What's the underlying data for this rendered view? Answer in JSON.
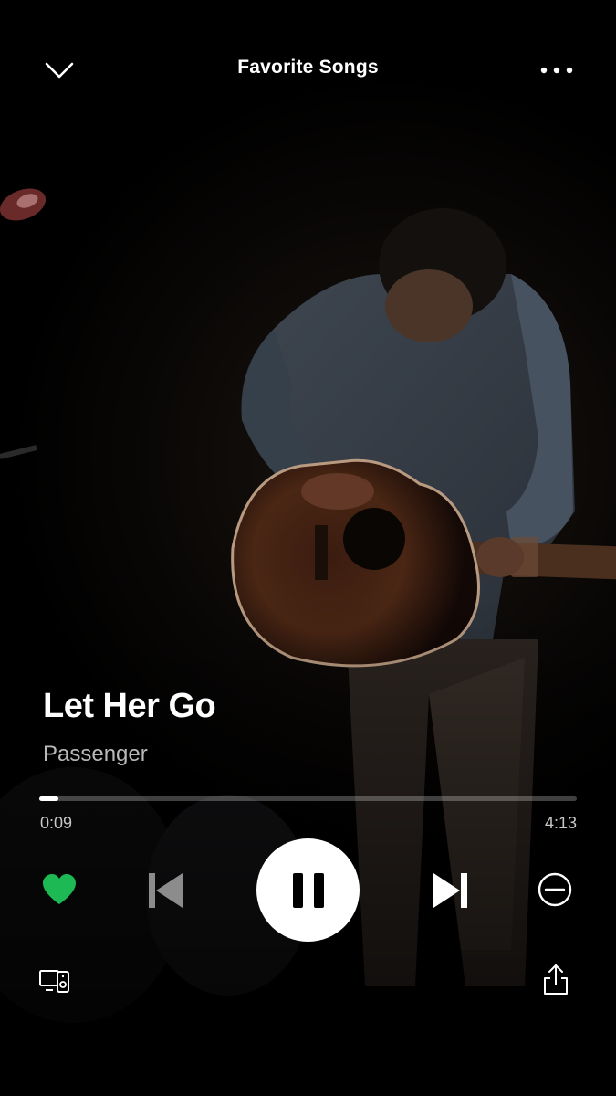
{
  "header": {
    "title": "Favorite Songs",
    "collapse_icon": "chevron-down-icon",
    "menu_icon": "more-horizontal-icon"
  },
  "track": {
    "title": "Let Her Go",
    "artist": "Passenger",
    "liked": true
  },
  "playback": {
    "elapsed": "0:09",
    "total": "4:13",
    "progress": 0.036,
    "state": "playing"
  },
  "controls": {
    "like_icon": "heart-icon",
    "previous_icon": "skip-previous-icon",
    "pause_icon": "pause-icon",
    "next_icon": "skip-next-icon",
    "hide_icon": "minus-circle-icon"
  },
  "footer": {
    "devices_icon": "devices-icon",
    "share_icon": "share-icon"
  },
  "colors": {
    "accent": "#1DB954",
    "background": "#000000",
    "text": "#FFFFFF",
    "muted": "#B9B9B9"
  }
}
